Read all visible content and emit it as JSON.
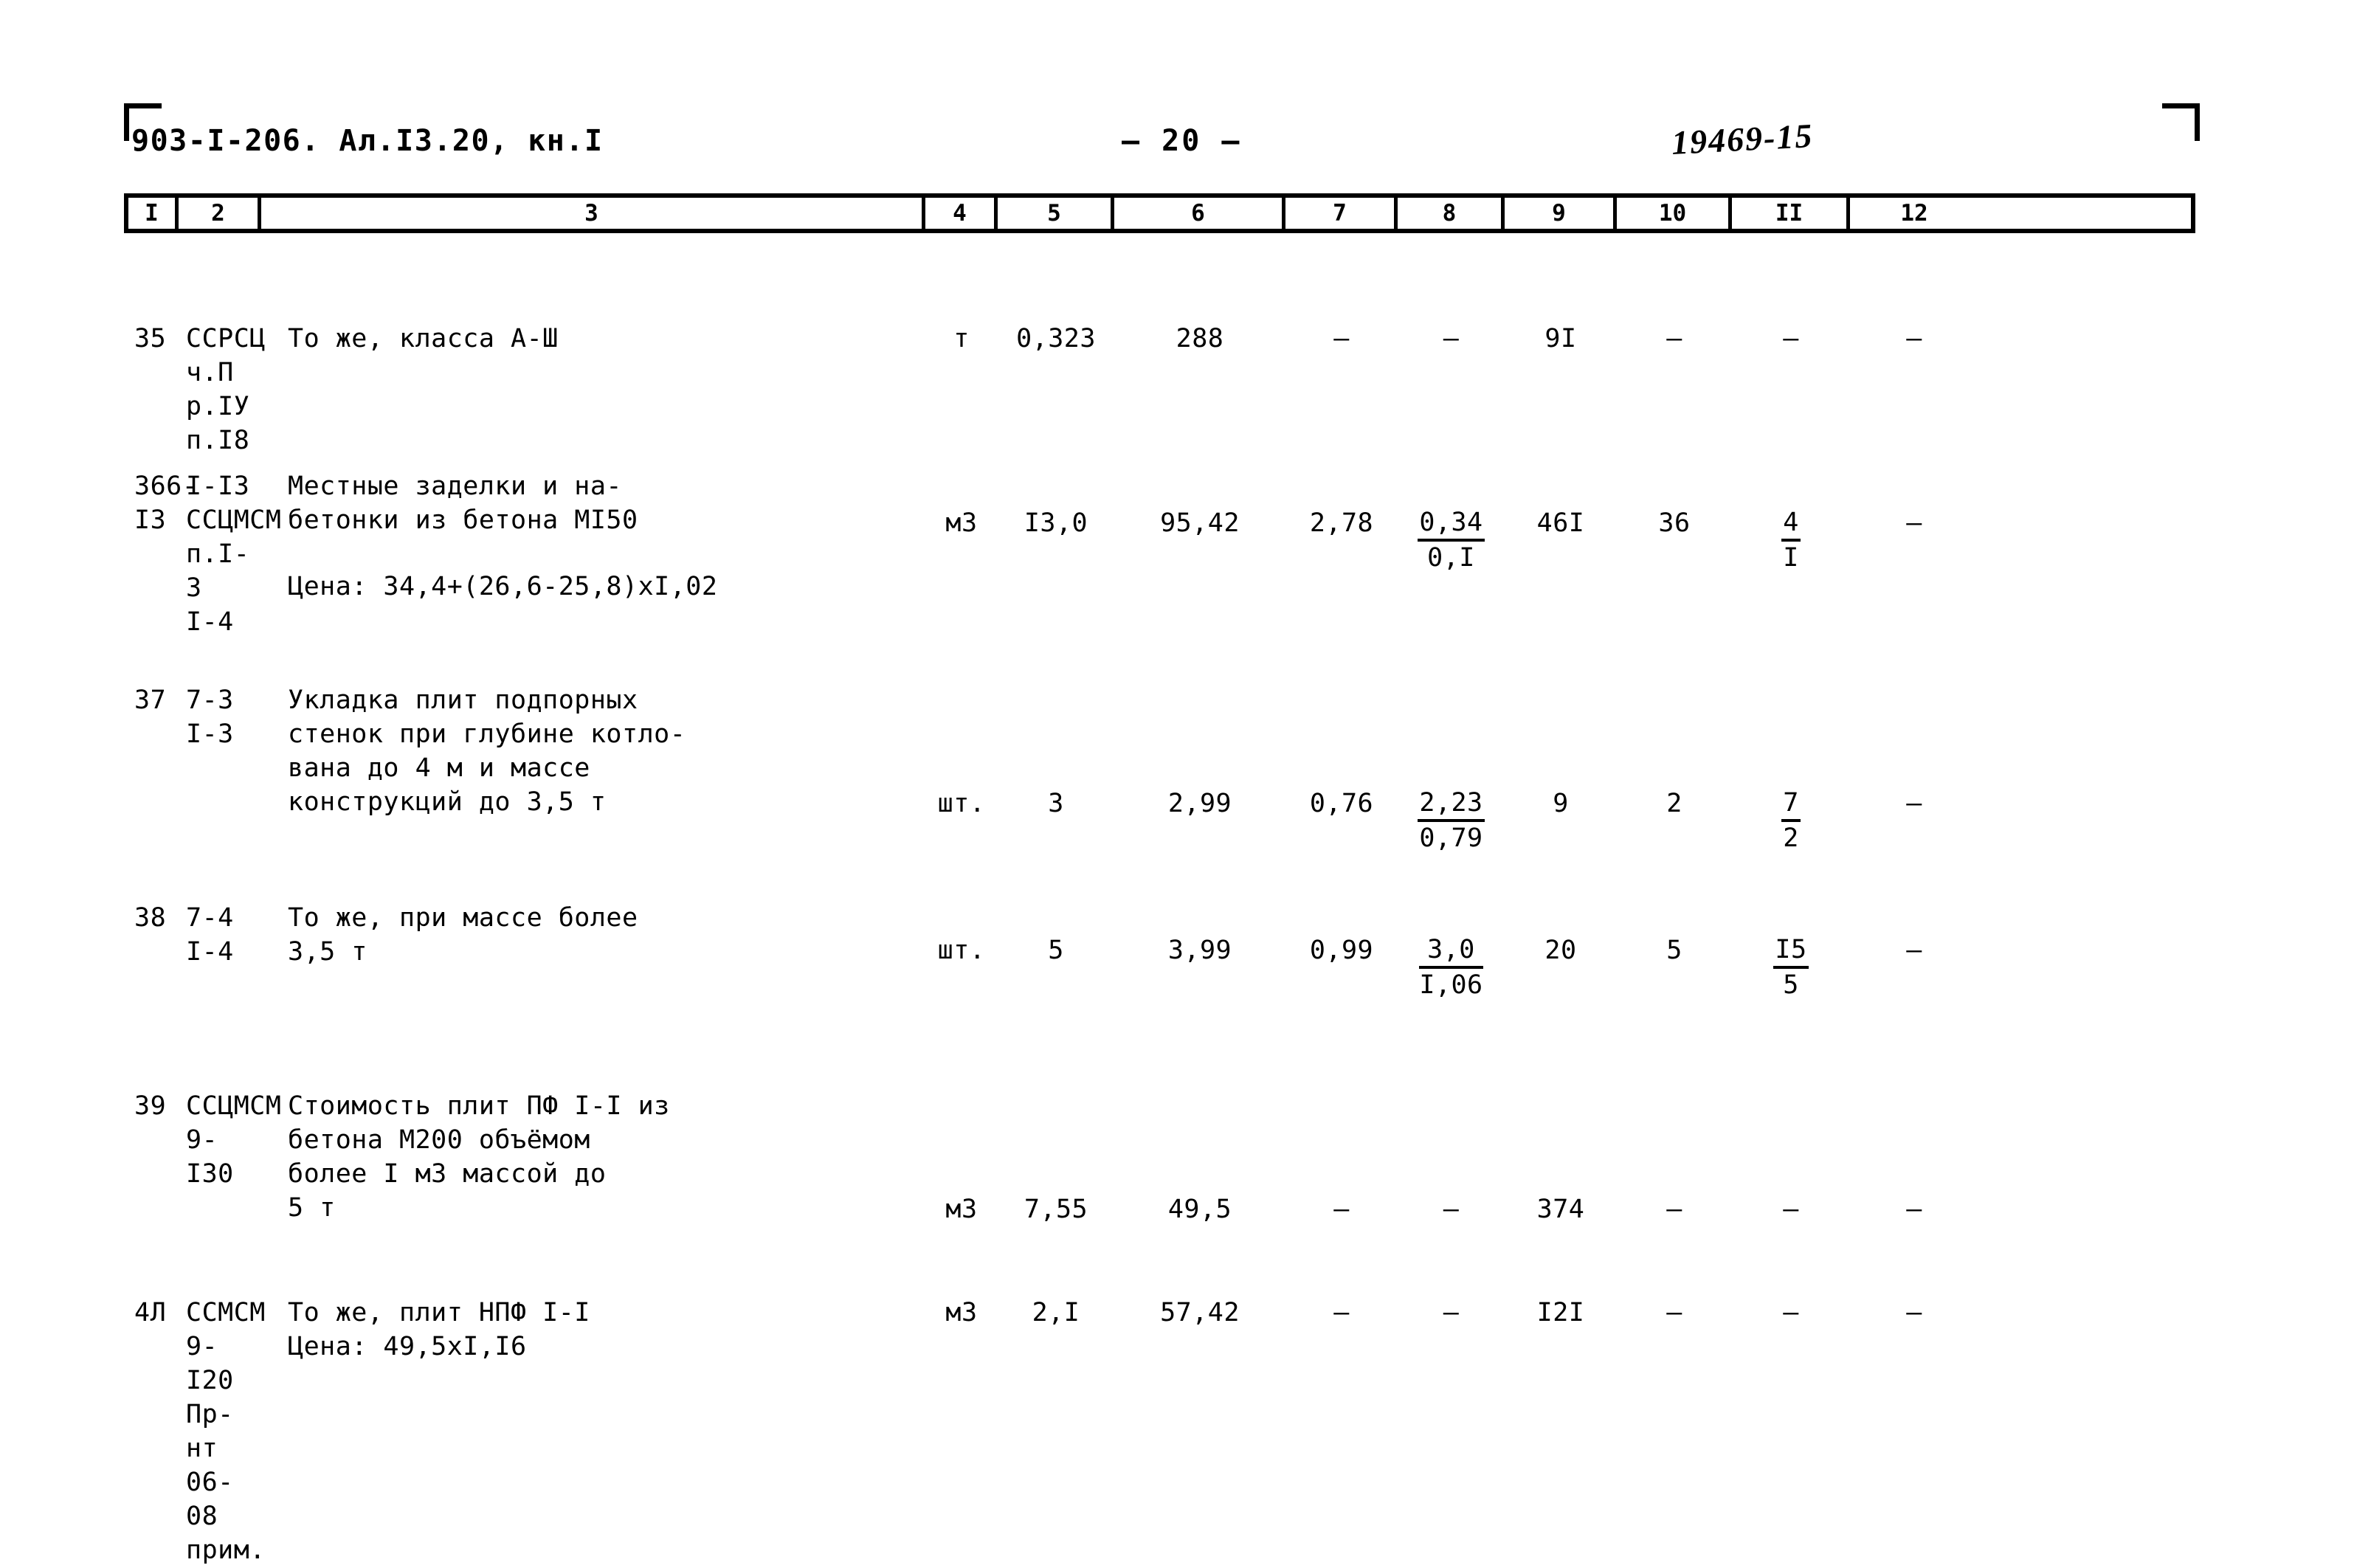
{
  "header": {
    "document_code": "903-I-206. Ал.I3.20, кн.I",
    "page_marker": "— 20 —",
    "archive_stamp": "19469-15"
  },
  "table": {
    "column_headers": [
      "I",
      "2",
      "3",
      "4",
      "5",
      "6",
      "7",
      "8",
      "9",
      "10",
      "II",
      "12"
    ],
    "rows": [
      {
        "num": "35",
        "code": "ССРСЦ\nч.П\nр.IУ\nп.I8",
        "desc": "То же, класса А-Ш",
        "unit": "т",
        "c5": "0,323",
        "c6": "288",
        "c7": "–",
        "c8": "–",
        "c8_top": "",
        "c8_bot": "",
        "c9": "9I",
        "c10": "–",
        "c11": "–",
        "c11_top": "",
        "c11_bot": "",
        "c12": "–"
      },
      {
        "num": "366-I3",
        "code": "I-I3\nССЦМСМ\nп.I-3\nI-4",
        "desc": "Местные заделки и на-\nбетонки из бетона МI50",
        "desc_extra": "Цена: 34,4+(26,6-25,8)хI,02",
        "unit": "м3",
        "c5": "I3,0",
        "c6": "95,42",
        "c7": "2,78",
        "c8_top": "0,34",
        "c8_bot": "0,I",
        "c9": "46I",
        "c10": "36",
        "c11_top": "4",
        "c11_bot": "I",
        "c12": "–"
      },
      {
        "num": "37",
        "code": "7-3\nI-3",
        "desc": "Укладка плит подпорных\nстенок при глубине котло-\nвана до 4 м и массе\nконструкций до 3,5 т",
        "unit": "шт.",
        "c5": "3",
        "c6": "2,99",
        "c7": "0,76",
        "c8_top": "2,23",
        "c8_bot": "0,79",
        "c9": "9",
        "c10": "2",
        "c11_top": "7",
        "c11_bot": "2",
        "c12": "–"
      },
      {
        "num": "38",
        "code": "7-4\nI-4",
        "desc": "То же, при массе более\n3,5 т",
        "unit": "шт.",
        "c5": "5",
        "c6": "3,99",
        "c7": "0,99",
        "c8_top": "3,0",
        "c8_bot": "I,06",
        "c9": "20",
        "c10": "5",
        "c11_top": "I5",
        "c11_bot": "5",
        "c12": "–"
      },
      {
        "num": "39",
        "code": "ССЦМСМ\n9-I30",
        "desc": "Стоимость плит ПФ I-I из\nбетона М200 объёмом\nболее I м3 массой до\n5 т",
        "unit": "м3",
        "c5": "7,55",
        "c6": "49,5",
        "c7": "–",
        "c8": "–",
        "c8_top": "",
        "c8_bot": "",
        "c9": "374",
        "c10": "–",
        "c11": "–",
        "c11_top": "",
        "c11_bot": "",
        "c12": "–"
      },
      {
        "num": "4Л",
        "code": "ССМСМ\n9-I20\nПр-нт\n06-08\nприм.",
        "desc": "То же, плит НПФ I-I\nЦена: 49,5хI,I6",
        "unit": "м3",
        "c5": "2,I",
        "c6": "57,42",
        "c7": "–",
        "c8": "–",
        "c8_top": "",
        "c8_bot": "",
        "c9": "I2I",
        "c10": "–",
        "c11": "–",
        "c11_top": "",
        "c11_bot": "",
        "c12": "–"
      }
    ]
  }
}
